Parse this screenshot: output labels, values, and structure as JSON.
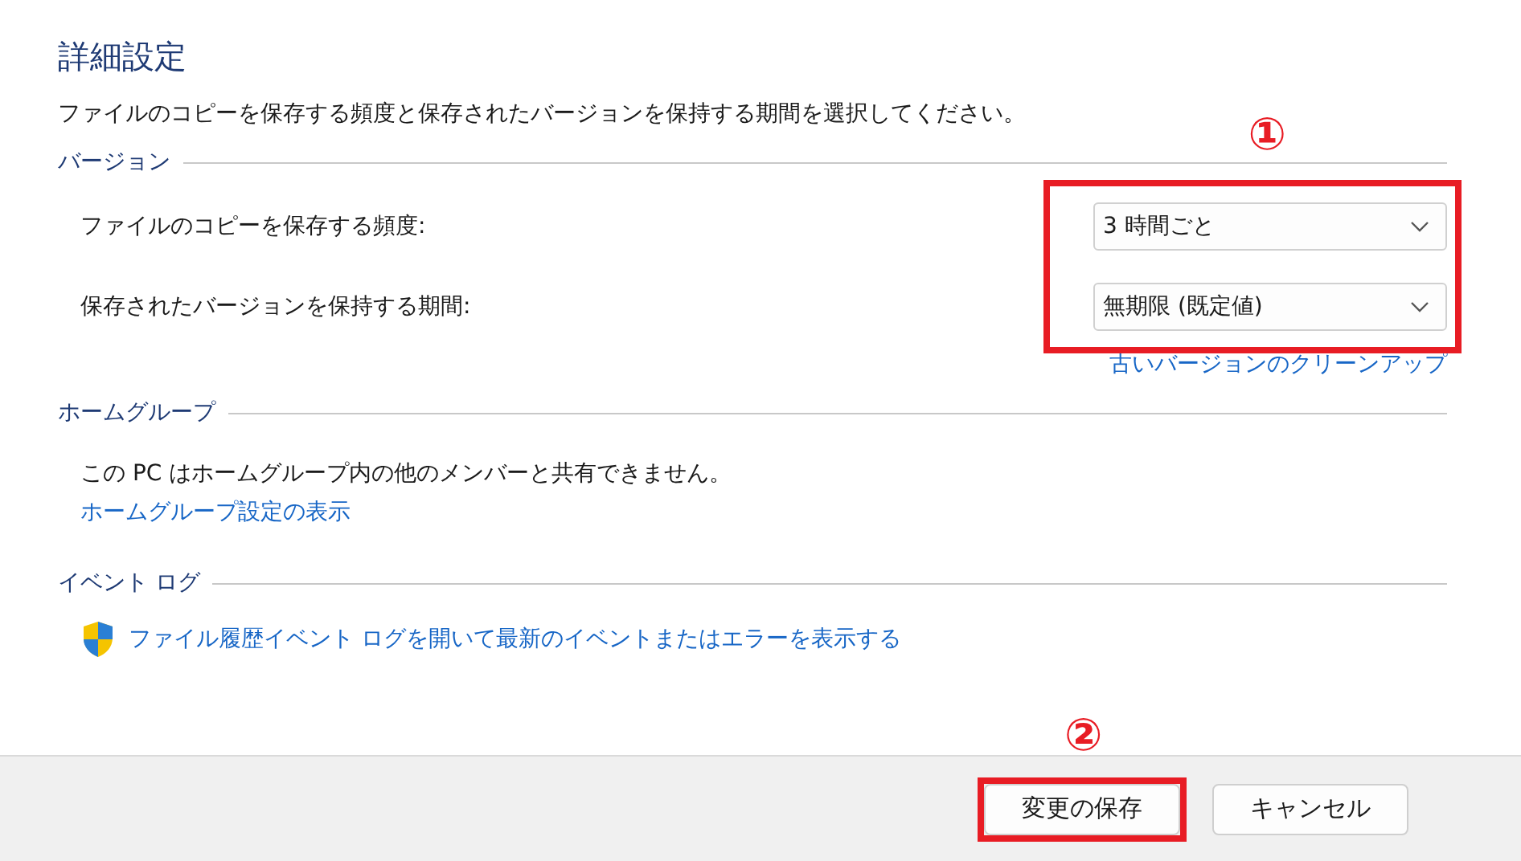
{
  "title": "詳細設定",
  "description": "ファイルのコピーを保存する頻度と保存されたバージョンを保持する期間を選択してください。",
  "versions": {
    "heading": "バージョン",
    "settings": [
      {
        "label": "ファイルのコピーを保存する頻度:",
        "value": "3 時間ごと"
      },
      {
        "label": "保存されたバージョンを保持する期間:",
        "value": "無期限 (既定値)"
      }
    ],
    "cleanup_link": "古いバージョンのクリーンアップ"
  },
  "homegroup": {
    "heading": "ホームグループ",
    "text": "この PC はホームグループ内の他のメンバーと共有できません。",
    "link": "ホームグループ設定の表示"
  },
  "event_log": {
    "heading": "イベント ログ",
    "link": "ファイル履歴イベント ログを開いて最新のイベントまたはエラーを表示する"
  },
  "buttons": [
    {
      "label": "変更の保存"
    },
    {
      "label": "キャンセル"
    }
  ],
  "annotations": [
    {
      "number": "①"
    },
    {
      "number": "②"
    }
  ]
}
